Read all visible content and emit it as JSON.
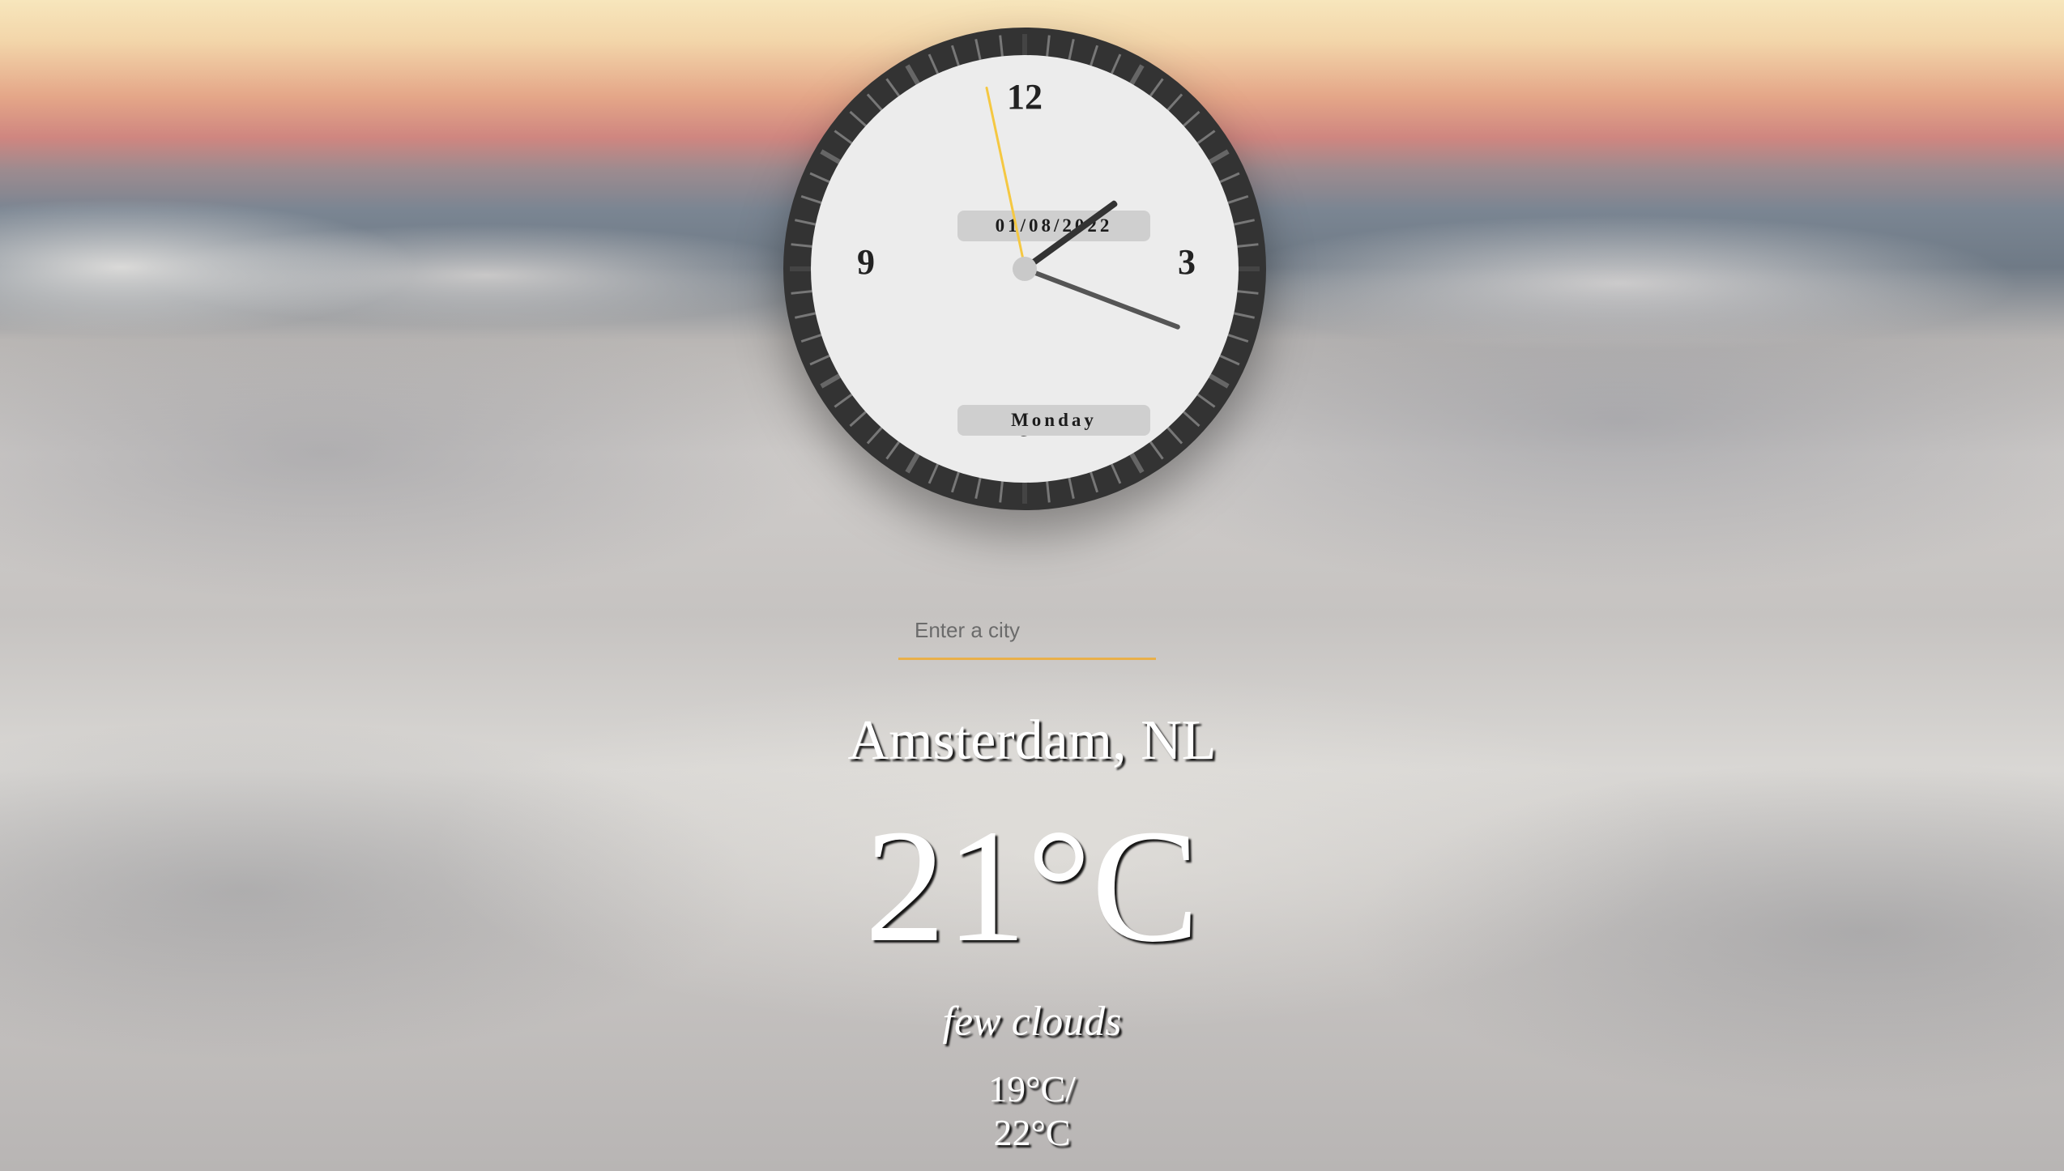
{
  "clock": {
    "numerals": {
      "n12": "12",
      "n3": "3",
      "n6": "6",
      "n9": "9"
    },
    "date": "01/08/2022",
    "day": "Monday",
    "time": {
      "hour": 1,
      "minute": 18,
      "second": 58
    }
  },
  "search": {
    "placeholder": "Enter a city",
    "value": "",
    "underline_color": "#e9b04a"
  },
  "weather": {
    "city": "Amsterdam, NL",
    "temperature": "21°C",
    "description": "few clouds",
    "min_temp": "19°C/",
    "max_temp": "22°C"
  },
  "icons": [
    "clock-icon"
  ]
}
